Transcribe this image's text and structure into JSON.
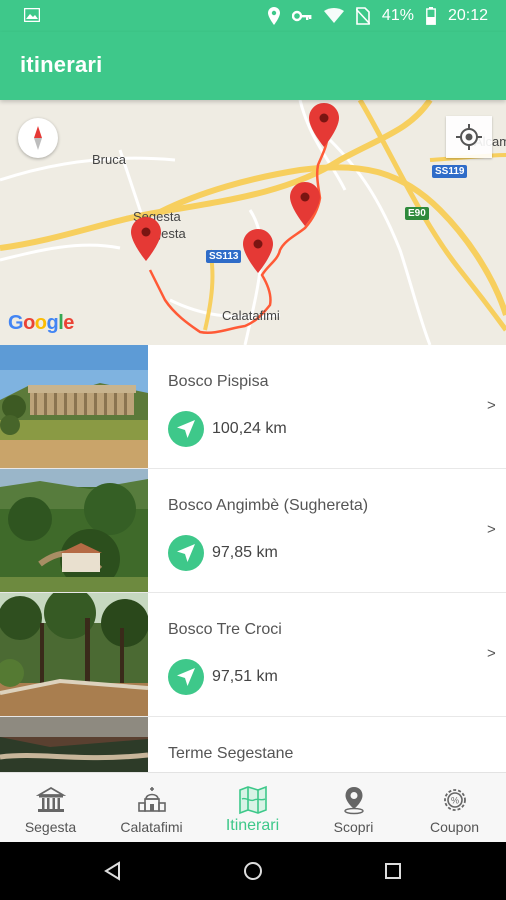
{
  "status_bar": {
    "battery": "41%",
    "time": "20:12"
  },
  "app_bar": {
    "title": "itinerari"
  },
  "map": {
    "labels": {
      "bruca": "Bruca",
      "segesta_top": "Segesta",
      "segesta_bottom": "Segesta",
      "calatafimi": "Calatafimi",
      "alcamo": "Alcamo",
      "ss113": "SS113",
      "ss119": "SS119",
      "e90": "E90"
    },
    "attribution": "Google",
    "markers": 4
  },
  "items": [
    {
      "name": "Bosco Pispisa",
      "distance": "100,24 km"
    },
    {
      "name": "Bosco Angimbè (Sughereta)",
      "distance": "97,85 km"
    },
    {
      "name": "Bosco Tre Croci",
      "distance": "97,51 km"
    },
    {
      "name": "Terme Segestane",
      "distance": ""
    }
  ],
  "chevron": ">",
  "tabs": [
    {
      "label": "Segesta",
      "icon": "temple-icon"
    },
    {
      "label": "Calatafimi",
      "icon": "church-icon"
    },
    {
      "label": "Itinerari",
      "icon": "map-icon",
      "active": true
    },
    {
      "label": "Scopri",
      "icon": "map-pin-icon"
    },
    {
      "label": "Coupon",
      "icon": "coupon-gear-icon"
    }
  ],
  "colors": {
    "accent": "#3ec88a",
    "route": "#ff5a36",
    "marker": "#e53935"
  }
}
